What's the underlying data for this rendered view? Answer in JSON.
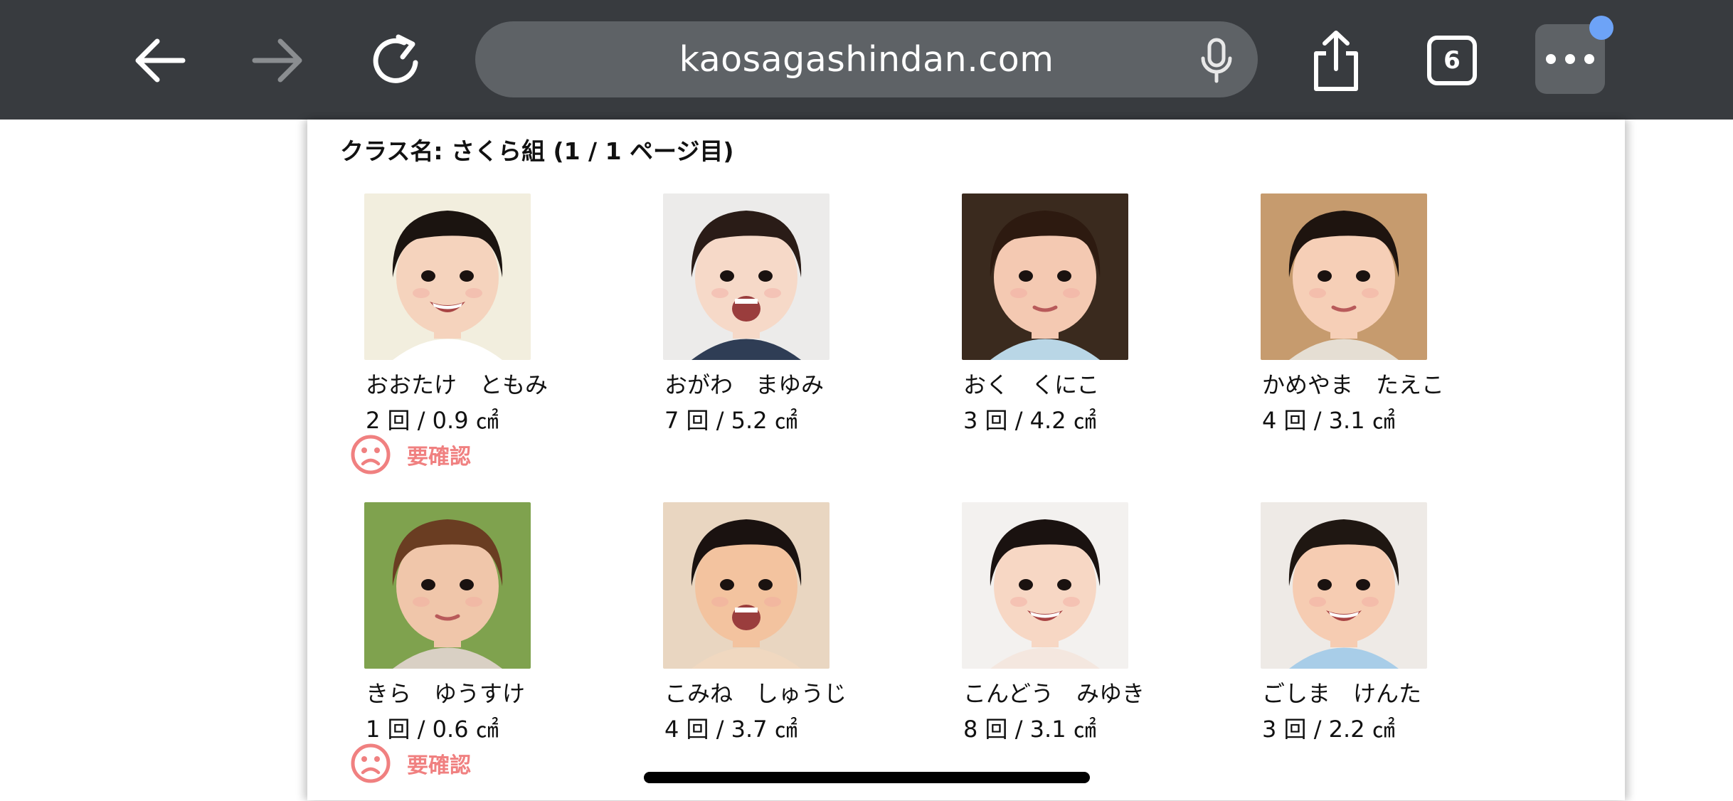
{
  "browser": {
    "url": "kaosagashindan.com",
    "tab_count": "6"
  },
  "page": {
    "class_title": "クラス名: さくら組 (1 / 1 ページ目)",
    "warning_label": "要確認",
    "children": [
      {
        "name": "おおたけ　ともみ",
        "stat": "2 回 / 0.9 ㎠",
        "needs_check": true,
        "hair": "#1b1410",
        "bg": "#f2eede",
        "skin": "#f5d3bd",
        "clothes": "#ffffff",
        "mouth": "smile"
      },
      {
        "name": "おがわ　まゆみ",
        "stat": "7 回 / 5.2 ㎠",
        "needs_check": false,
        "hair": "#2a1c17",
        "bg": "#ecebea",
        "skin": "#f6d9c8",
        "clothes": "#2f3d55",
        "mouth": "open"
      },
      {
        "name": "おく　くにこ",
        "stat": "3 回 / 4.2 ㎠",
        "needs_check": false,
        "hair": "#2d1a10",
        "bg": "#3a2a1e",
        "skin": "#f4c9b2",
        "clothes": "#b9d6e6",
        "mouth": "neutral"
      },
      {
        "name": "かめやま　たえこ",
        "stat": "4 回 / 3.1 ㎠",
        "needs_check": false,
        "hair": "#1e140f",
        "bg": "#c69b6e",
        "skin": "#f6cfb7",
        "clothes": "#e5ded3",
        "mouth": "neutral"
      },
      {
        "name": "きら　ゆうすけ",
        "stat": "1 回 / 0.6 ㎠",
        "needs_check": true,
        "hair": "#6a3d22",
        "bg": "#7fa24e",
        "skin": "#f0c6aa",
        "clothes": "#d9d0c4",
        "mouth": "neutral"
      },
      {
        "name": "こみね　しゅうじ",
        "stat": "4 回 / 3.7 ㎠",
        "needs_check": false,
        "hair": "#1a1210",
        "bg": "#e9d6c1",
        "skin": "#f3c39f",
        "clothes": "#f0d8c0",
        "mouth": "open"
      },
      {
        "name": "こんどう　みゆき",
        "stat": "8 回 / 3.1 ㎠",
        "needs_check": false,
        "hair": "#1a1210",
        "bg": "#f3f1ef",
        "skin": "#f7d7c4",
        "clothes": "#f4e7df",
        "mouth": "smile"
      },
      {
        "name": "ごしま　けんた",
        "stat": "3 回 / 2.2 ㎠",
        "needs_check": false,
        "hair": "#1f1712",
        "bg": "#eeeae6",
        "skin": "#f6ccb2",
        "clothes": "#a8cde8",
        "mouth": "smile"
      }
    ]
  },
  "colors": {
    "toolbar_bg": "#383b3f",
    "urlbar_bg": "#5e6266",
    "warning": "#f08080",
    "notification": "#6da3f7"
  }
}
